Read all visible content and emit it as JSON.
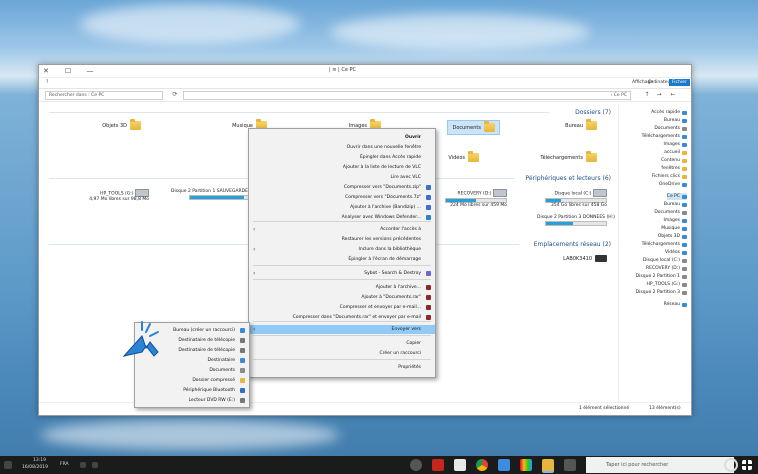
{
  "window": {
    "title": "Ce PC",
    "title_prefix": "| ≡ | Ce PC",
    "controls": {
      "minimize": "—",
      "maximize": "☐",
      "close": "✕"
    },
    "tabs": [
      "Fichier",
      "Ordinateur",
      "Affichage"
    ],
    "help": "?",
    "address": "› Ce PC",
    "search_placeholder": "Rechercher dans : Ce PC",
    "nav": {
      "back": "←",
      "forward": "→",
      "up": "↑",
      "refresh": "⟳"
    }
  },
  "content": {
    "folders_group": "Dossiers (7)",
    "folders": [
      "Bureau",
      "Documents",
      "Images",
      "Musique",
      "Objets 3D",
      "Téléchargements",
      "Vidéos"
    ],
    "drives_group": "Périphériques et lecteurs (6)",
    "drives": [
      {
        "name": "Disque local (C:)",
        "free": "354 Go libres sur 458 Go",
        "fill": 0.25
      },
      {
        "name": "RECOVERY (D:)",
        "free": "224 Mo libres sur 459 Mo",
        "fill": 0.5
      },
      {
        "name": "Disque 2 Partition 1 SAUVEGARDES (F:)",
        "free": "",
        "fill": 0.9
      },
      {
        "name": "HP_TOOLS (G:)",
        "free": "4,97 Mo libres sur 98,8 Mo",
        "fill": 0.95
      },
      {
        "name": "Disque 2 Partition 3 DONNEES (H:)",
        "free": "",
        "fill": 0.45
      }
    ],
    "network_group": "Emplacements réseau (2)",
    "network": [
      "LAB0K3410"
    ]
  },
  "sidebar": {
    "items": [
      {
        "label": "Accès rapide",
        "color": "#3b8ad9"
      },
      {
        "label": "Bureau",
        "color": "#3b8ad9"
      },
      {
        "label": "Documents",
        "color": "#8a8a8a"
      },
      {
        "label": "Téléchargements",
        "color": "#3b8ad9"
      },
      {
        "label": "Images",
        "color": "#3b8ad9"
      },
      {
        "label": "accueil",
        "color": "#e8b63c"
      },
      {
        "label": "Contenu",
        "color": "#e8b63c"
      },
      {
        "label": "fenêtres",
        "color": "#e8b63c"
      },
      {
        "label": "Fichiers clics",
        "color": "#e8b63c"
      },
      {
        "label": "OneDrive",
        "color": "#3b8ad9"
      },
      {
        "label": "Ce PC",
        "color": "#3b8ad9"
      },
      {
        "label": "Bureau",
        "color": "#3b8ad9"
      },
      {
        "label": "Documents",
        "color": "#8a8a8a"
      },
      {
        "label": "Images",
        "color": "#3b8ad9"
      },
      {
        "label": "Musique",
        "color": "#3b8ad9"
      },
      {
        "label": "Objets 3D",
        "color": "#3b8ad9"
      },
      {
        "label": "Téléchargements",
        "color": "#3b8ad9"
      },
      {
        "label": "Vidéos",
        "color": "#3b8ad9"
      },
      {
        "label": "Disque local (C:)",
        "color": "#8a8a8a"
      },
      {
        "label": "RECOVERY (D:)",
        "color": "#8a8a8a"
      },
      {
        "label": "Disque 2 Partition 1",
        "color": "#8a8a8a"
      },
      {
        "label": "HP_TOOLS (G:)",
        "color": "#8a8a8a"
      },
      {
        "label": "Disque 2 Partition 3",
        "color": "#8a8a8a"
      },
      {
        "label": "Réseau",
        "color": "#3b8ad9"
      }
    ]
  },
  "status": {
    "left": "13 élément(s)",
    "right": "1 élément sélectionné"
  },
  "context_menu": {
    "items": [
      {
        "label": "Ouvrir",
        "bold": true
      },
      {
        "label": "Ouvrir dans une nouvelle fenêtre"
      },
      {
        "label": "Épingler dans Accès rapide"
      },
      {
        "label": "Ajouter à la liste de lecture de VLC"
      },
      {
        "label": "Lire avec VLC"
      },
      {
        "label": "Compresser vers \"Documents.zip\"",
        "icon": "#3b6fd0"
      },
      {
        "label": "Compresser vers \"Documents.7z\"",
        "icon": "#3b6fd0"
      },
      {
        "label": "Ajouter à l'archive (Bandizip) ...",
        "icon": "#3b6fd0"
      },
      {
        "label": "Analyser avec Windows Defender...",
        "icon": "#2f7fd1"
      },
      {
        "label": "Accorder l'accès à",
        "submenu": true
      },
      {
        "label": "Restaurer les versions précédentes"
      },
      {
        "label": "Inclure dans la bibliothèque",
        "submenu": true
      },
      {
        "label": "Épingler à l'écran de démarrage"
      },
      {
        "label": "Sybot - Search & Destroy",
        "icon": "#6a6ad0",
        "submenu": true
      },
      {
        "label": "Ajouter à l'archive...",
        "icon": "#8b2a2a"
      },
      {
        "label": "Ajouter à \"Documents.rar\"",
        "icon": "#8b2a2a"
      },
      {
        "label": "Compresser et envoyer par e-mail...",
        "icon": "#8b2a2a"
      },
      {
        "label": "Compresser dans \"Documents.rar\" et envoyer par e-mail",
        "icon": "#8b2a2a"
      },
      {
        "label": "Envoyer vers",
        "submenu": true,
        "highlighted": true
      },
      {
        "label": "Copier"
      },
      {
        "label": "Créer un raccourci"
      },
      {
        "label": "Propriétés"
      }
    ]
  },
  "send_to_menu": {
    "items": [
      {
        "label": "Bureau (créer un raccourci)",
        "icon": "#3b8ad9"
      },
      {
        "label": "Destinataire de télécopie",
        "icon": "#777"
      },
      {
        "label": "Destinataire de télécopie",
        "icon": "#777"
      },
      {
        "label": "Destinataire",
        "icon": "#3b8ad9"
      },
      {
        "label": "Documents",
        "icon": "#8a8a8a"
      },
      {
        "label": "Dossier compressé",
        "icon": "#e8b63c"
      },
      {
        "label": "Périphérique Bluetooth",
        "icon": "#2f6fd1"
      },
      {
        "label": "Lecteur DVD RW (E:)",
        "icon": "#777"
      }
    ]
  },
  "taskbar": {
    "search_placeholder": "Taper ici pour rechercher",
    "time": "13:19",
    "date": "16/08/2019",
    "lang": "FRA"
  }
}
